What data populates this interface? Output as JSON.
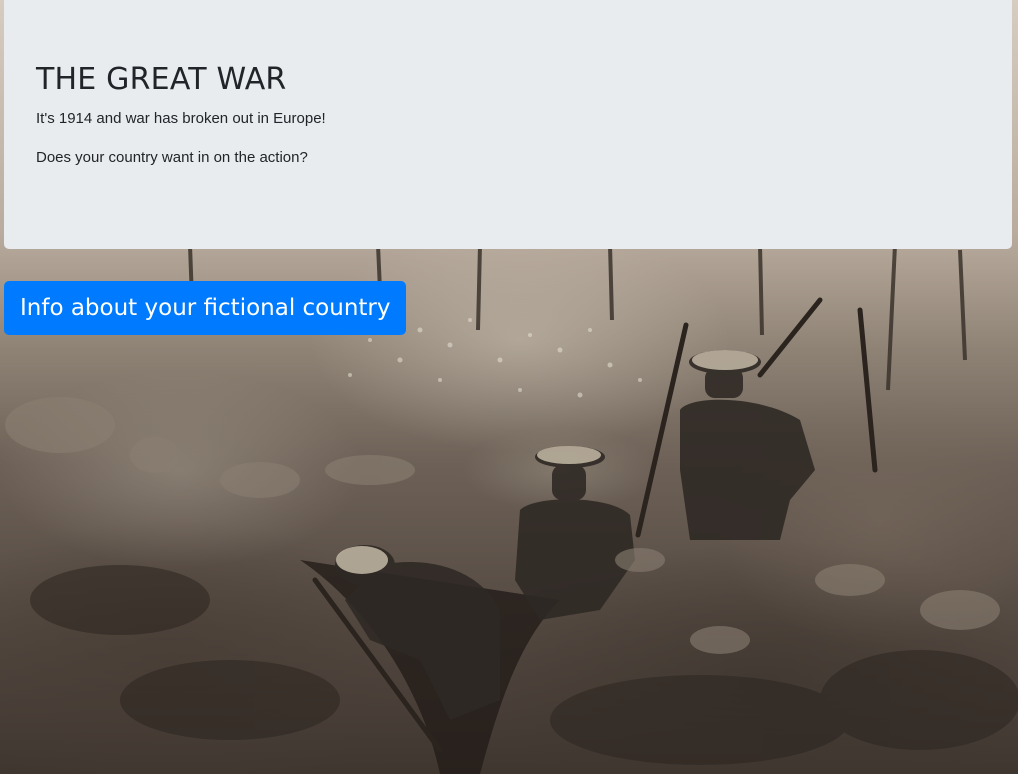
{
  "jumbotron": {
    "title": "THE GREAT WAR",
    "intro": "It's 1914 and war has broken out in Europe!",
    "question": "Does your country want in on the action?"
  },
  "actions": {
    "info_button_label": "Info about your fictional country"
  },
  "colors": {
    "panel_background": "#e9ecef",
    "primary_button": "#007bff",
    "text": "#212529"
  }
}
